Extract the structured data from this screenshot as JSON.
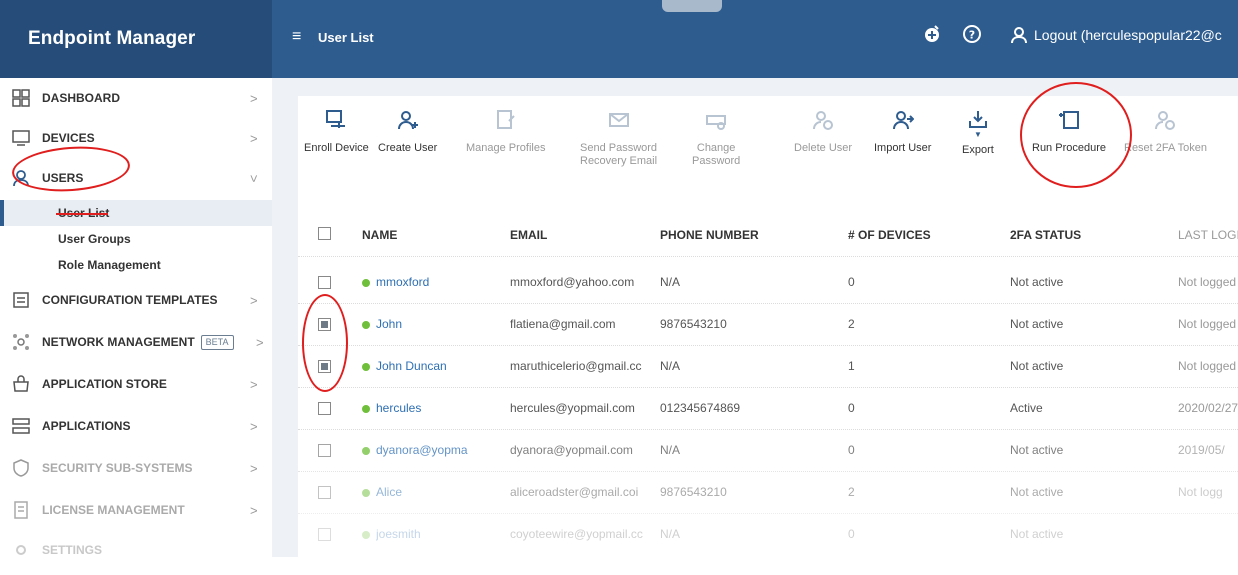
{
  "header": {
    "app_title": "Endpoint Manager",
    "menu_icon": "hamburger-icon",
    "page_title": "User List",
    "logout_label": "Logout (herculespopular22@c",
    "icons": [
      "add-circle-icon",
      "help-icon",
      "user-icon"
    ]
  },
  "sidebar": {
    "items": [
      {
        "label": "DASHBOARD",
        "icon": "dashboard-icon"
      },
      {
        "label": "DEVICES",
        "icon": "devices-icon"
      },
      {
        "label": "USERS",
        "icon": "user-icon"
      },
      {
        "label": "CONFIGURATION TEMPLATES",
        "icon": "configuration-icon"
      },
      {
        "label": "NETWORK MANAGEMENT",
        "icon": "network-icon",
        "badge": "BETA"
      },
      {
        "label": "APPLICATION STORE",
        "icon": "store-icon"
      },
      {
        "label": "APPLICATIONS",
        "icon": "applications-icon"
      },
      {
        "label": "SECURITY SUB-SYSTEMS",
        "icon": "shield-icon"
      },
      {
        "label": "LICENSE MANAGEMENT",
        "icon": "license-icon"
      },
      {
        "label": "SETTINGS",
        "icon": "gear-icon"
      }
    ],
    "users_sub": [
      "User List",
      "User Groups",
      "Role Management"
    ]
  },
  "toolbar": {
    "buttons": [
      {
        "label": "Enroll Device",
        "icon": "enroll-device-icon",
        "enabled": true
      },
      {
        "label": "Create User",
        "icon": "add-user-icon",
        "enabled": true
      },
      {
        "label": "Manage Profiles",
        "icon": "manage-profiles-icon",
        "enabled": false
      },
      {
        "label": "Send Password Recovery Email",
        "line1": "Send Password",
        "line2": "Recovery Email",
        "icon": "mail-icon",
        "enabled": false
      },
      {
        "label": "Change Password",
        "line1": "Change",
        "line2": "Password",
        "icon": "password-icon",
        "enabled": false
      },
      {
        "label": "Delete User",
        "icon": "delete-user-icon",
        "enabled": false
      },
      {
        "label": "Import User",
        "icon": "import-user-icon",
        "enabled": true
      },
      {
        "label": "Export",
        "icon": "export-icon",
        "enabled": true
      },
      {
        "label": "Run Procedure",
        "icon": "run-procedure-icon",
        "enabled": true
      },
      {
        "label": "Reset 2FA Token",
        "icon": "reset-token-icon",
        "enabled": false
      }
    ]
  },
  "table": {
    "columns": [
      "NAME",
      "EMAIL",
      "PHONE NUMBER",
      "# OF DEVICES",
      "2FA STATUS",
      "LAST LOGIN"
    ],
    "rows": [
      {
        "name": "mmoxford",
        "email": "mmoxford@yahoo.com",
        "phone": "N/A",
        "devices": "0",
        "status": "Not active",
        "last_login": "Not logged i",
        "checked": false
      },
      {
        "name": "John",
        "email": "flatiena@gmail.com",
        "phone": "9876543210",
        "devices": "2",
        "status": "Not active",
        "last_login": "Not logged i",
        "checked": true
      },
      {
        "name": "John Duncan",
        "email": "maruthicelerio@gmail.cc",
        "phone": "N/A",
        "devices": "1",
        "status": "Not active",
        "last_login": "Not logged i",
        "checked": true
      },
      {
        "name": "hercules",
        "email": "hercules@yopmail.com",
        "phone": "012345674869",
        "devices": "0",
        "status": "Active",
        "last_login": "2020/02/27",
        "checked": false
      },
      {
        "name": "dyanora@yopma",
        "email": "dyanora@yopmail.com",
        "phone": "N/A",
        "devices": "0",
        "status": "Not active",
        "last_login": "2019/05/",
        "checked": false
      },
      {
        "name": "Alice",
        "email": "aliceroadster@gmail.coi",
        "phone": "9876543210",
        "devices": "2",
        "status": "Not active",
        "last_login": "Not logg",
        "checked": false
      },
      {
        "name": "joesmith",
        "email": "coyoteewire@yopmail.cc",
        "phone": "N/A",
        "devices": "0",
        "status": "Not active",
        "last_login": "",
        "checked": false
      }
    ]
  },
  "colors": {
    "header": "#2e5c8f",
    "accent": "#2e6fb3",
    "status_dot": "#6fbf3a",
    "annotation": "#e01e1e"
  }
}
